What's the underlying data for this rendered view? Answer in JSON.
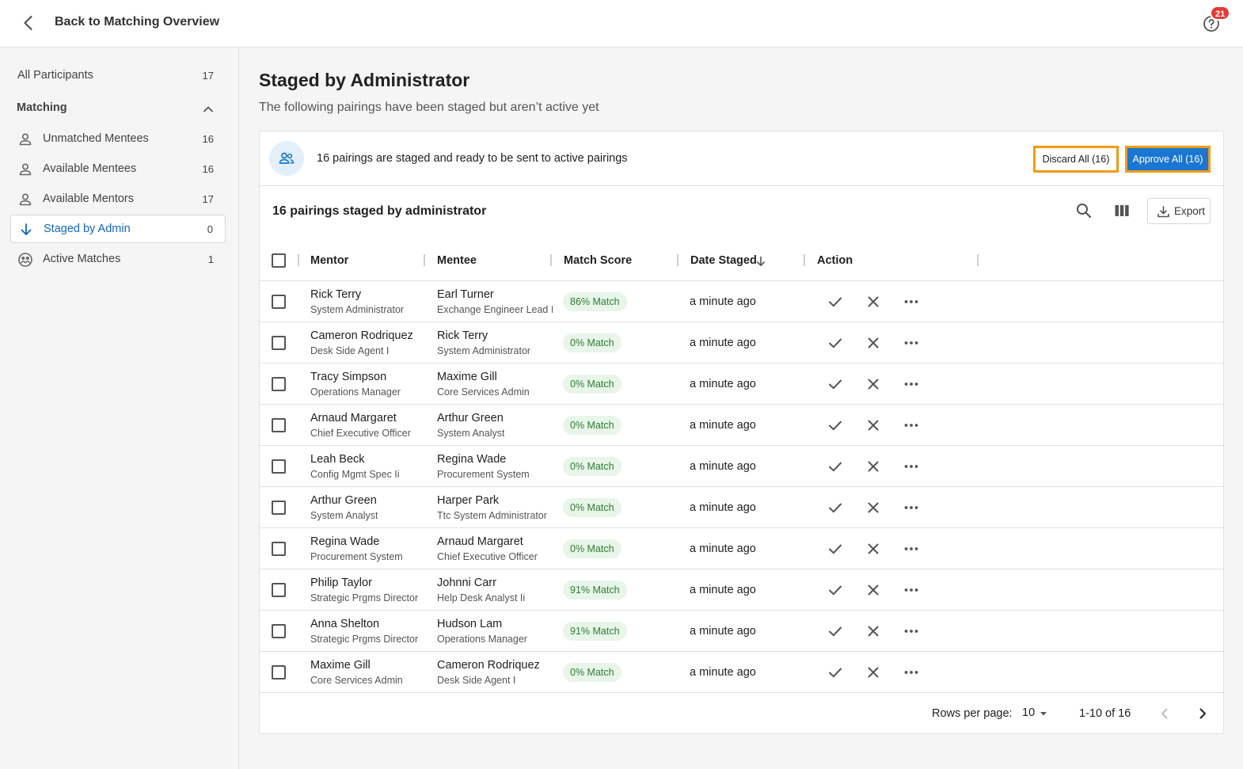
{
  "header": {
    "back_label": "Back to Matching Overview",
    "notification_count": "21"
  },
  "sidebar": {
    "all_participants": {
      "label": "All Participants",
      "count": "17"
    },
    "section_label": "Matching",
    "items": [
      {
        "label": "Unmatched Mentees",
        "count": "16",
        "icon": "person-icon"
      },
      {
        "label": "Available Mentees",
        "count": "16",
        "icon": "person-icon"
      },
      {
        "label": "Available Mentors",
        "count": "17",
        "icon": "person-icon"
      },
      {
        "label": "Staged by Admin",
        "count": "0",
        "icon": "arrow-down-icon",
        "active": true
      },
      {
        "label": "Active Matches",
        "count": "1",
        "icon": "matches-icon"
      }
    ]
  },
  "main": {
    "title": "Staged by Administrator",
    "subtitle": "The following pairings have been staged but aren’t active yet",
    "banner": {
      "text": "16 pairings are staged and ready to be sent to active pairings",
      "discard_label": "Discard All (16)",
      "approve_label": "Approve All (16)"
    },
    "table": {
      "title": "16 pairings staged by administrator",
      "export_label": "Export",
      "columns": [
        "Mentor",
        "Mentee",
        "Match Score",
        "Date Staged",
        "Action"
      ],
      "rows": [
        {
          "mentor": "Rick Terry",
          "mentor_role": "System Administrator",
          "mentee": "Earl Turner",
          "mentee_role": "Exchange Engineer Lead I",
          "score": "86% Match",
          "date": "a minute ago"
        },
        {
          "mentor": "Cameron Rodriquez",
          "mentor_role": "Desk Side Agent I",
          "mentee": "Rick Terry",
          "mentee_role": "System Administrator",
          "score": "0% Match",
          "date": "a minute ago"
        },
        {
          "mentor": "Tracy Simpson",
          "mentor_role": "Operations Manager",
          "mentee": "Maxime Gill",
          "mentee_role": "Core Services Admin",
          "score": "0% Match",
          "date": "a minute ago"
        },
        {
          "mentor": "Arnaud Margaret",
          "mentor_role": "Chief Executive Officer",
          "mentee": "Arthur Green",
          "mentee_role": "System Analyst",
          "score": "0% Match",
          "date": "a minute ago"
        },
        {
          "mentor": "Leah Beck",
          "mentor_role": "Config Mgmt Spec Ii",
          "mentee": "Regina Wade",
          "mentee_role": "Procurement System",
          "score": "0% Match",
          "date": "a minute ago"
        },
        {
          "mentor": "Arthur Green",
          "mentor_role": "System Analyst",
          "mentee": "Harper Park",
          "mentee_role": "Ttc System Administrator",
          "score": "0% Match",
          "date": "a minute ago"
        },
        {
          "mentor": "Regina Wade",
          "mentor_role": "Procurement System",
          "mentee": "Arnaud Margaret",
          "mentee_role": "Chief Executive Officer",
          "score": "0% Match",
          "date": "a minute ago"
        },
        {
          "mentor": "Philip Taylor",
          "mentor_role": "Strategic Prgms Director",
          "mentee": "Johnni Carr",
          "mentee_role": "Help Desk Analyst Ii",
          "score": "91% Match",
          "date": "a minute ago"
        },
        {
          "mentor": "Anna Shelton",
          "mentor_role": "Strategic Prgms Director",
          "mentee": "Hudson Lam",
          "mentee_role": "Operations Manager",
          "score": "91% Match",
          "date": "a minute ago"
        },
        {
          "mentor": "Maxime Gill",
          "mentor_role": "Core Services Admin",
          "mentee": "Cameron Rodriquez",
          "mentee_role": "Desk Side Agent I",
          "score": "0% Match",
          "date": "a minute ago"
        }
      ]
    },
    "pagination": {
      "rows_per_page_label": "Rows per page:",
      "rows_per_page_value": "10",
      "range": "1-10 of 16"
    }
  },
  "colors": {
    "accent": "#1976d2",
    "highlight_outline": "#f39c12",
    "chip_bg": "#e8f5e9",
    "chip_text": "#2e7d32",
    "badge": "#e53935"
  }
}
